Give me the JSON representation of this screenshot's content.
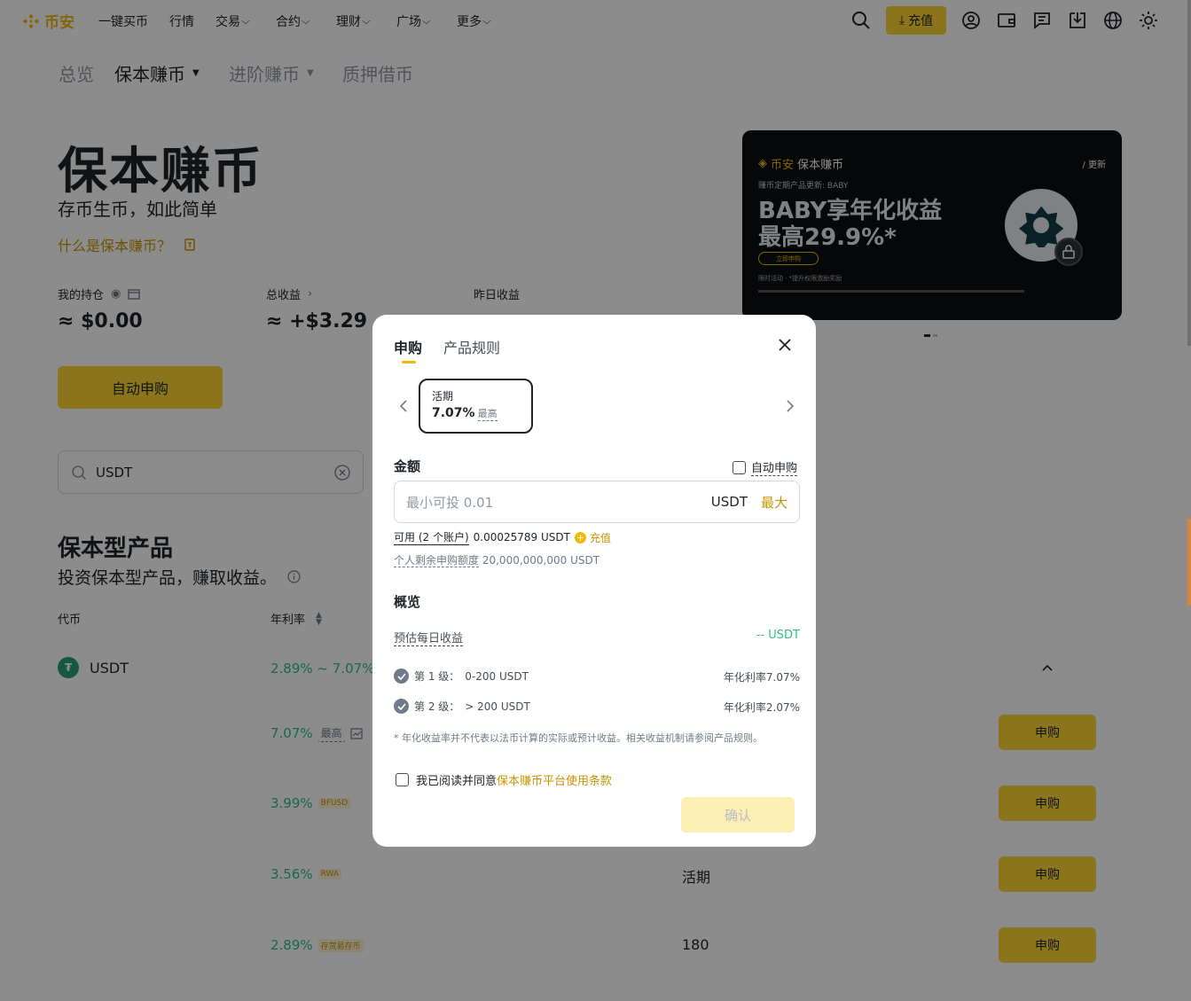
{
  "nav": {
    "logo": "币安",
    "items": [
      "一键买币",
      "行情",
      "交易",
      "合约",
      "理财",
      "广场",
      "更多"
    ],
    "deposit_label": "充值"
  },
  "subnav": {
    "items": [
      "总览",
      "保本赚币",
      "进阶赚币",
      "质押借币"
    ],
    "active_index": 1
  },
  "hero": {
    "title": "保本赚币",
    "subtitle": "存币生币，如此简单",
    "what_link": "什么是保本赚币？"
  },
  "stats": {
    "holdings_label": "我的持仓",
    "holdings_value": "≈ $0.00",
    "total_label": "总收益",
    "total_value": "≈ +$3.29",
    "yesterday_label": "昨日收益"
  },
  "auto_subscribe_btn": "自动申购",
  "banner": {
    "brand_gold": "币安",
    "brand_white": "保本赚币",
    "update": "/ 更新",
    "small": "赚币定期产品更新: BABY",
    "headline1": "BABY享年化收益",
    "headline2": "最高29.9%*",
    "button": "立即申购",
    "note": "限时活动 · *提升权限激励奖励"
  },
  "search": {
    "value": "USDT"
  },
  "products": {
    "title": "保本型产品",
    "subtitle": "投资保本型产品，赚取收益。",
    "col_coin": "代币",
    "col_apr": "年利率",
    "coin": "USDT",
    "coin_range": "2.89% ~ 7.07%",
    "rows": [
      {
        "rate": "7.07%",
        "tag": "最高",
        "term": "",
        "button": "申购"
      },
      {
        "rate": "3.99%",
        "tag": "BFUSD",
        "term": "",
        "button": "申购"
      },
      {
        "rate": "3.56%",
        "tag": "RWA",
        "term": "活期",
        "button": "申购"
      },
      {
        "rate": "2.89%",
        "tag": "存赏易存币",
        "term": "180",
        "button": "申购"
      }
    ]
  },
  "modal": {
    "tab_subscribe": "申购",
    "tab_rules": "产品规则",
    "plan_type": "活期",
    "plan_rate": "7.07%",
    "plan_rate_tag": "最高",
    "amount_label": "金额",
    "auto_subscribe": "自动申购",
    "amount_placeholder": "最小可投 0.01",
    "amount_unit": "USDT",
    "max_label": "最大",
    "available_label": "可用 (2 个账户)",
    "available_value": "0.00025789 USDT",
    "deposit_label": "充值",
    "quota_label": "个人剩余申购额度",
    "quota_value": "20,000,000,000 USDT",
    "overview_title": "概览",
    "est_daily_label": "预估每日收益",
    "est_daily_value": "-- USDT",
    "tiers": [
      {
        "label": "第 1 级：",
        "range": "0-200 USDT",
        "rate": "年化利率7.07%"
      },
      {
        "label": "第 2 级：",
        "range": "> 200 USDT",
        "rate": "年化利率2.07%"
      }
    ],
    "footnote": "* 年化收益率并不代表以法币计算的实际或预计收益。相关收益机制请参阅产品规则。",
    "agree_text": "我已阅读并同意",
    "agree_link": "保本赚币平台使用条款",
    "confirm": "确认"
  },
  "colors": {
    "brand": "#f0b90b",
    "button": "#fcd535",
    "positive": "#2ebd85"
  }
}
